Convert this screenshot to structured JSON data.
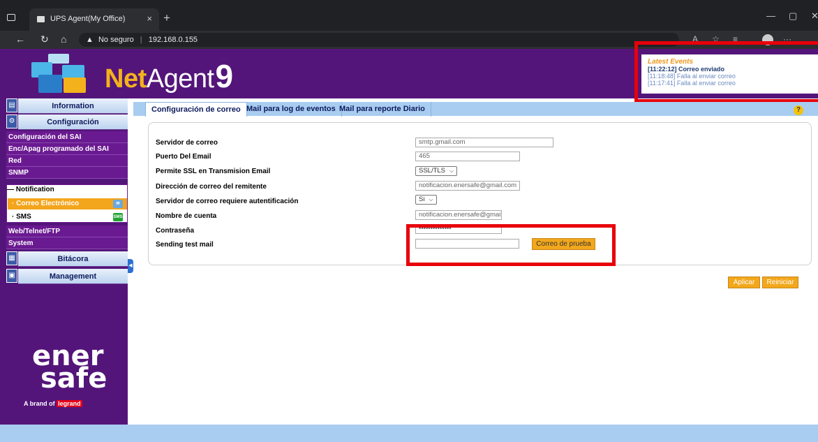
{
  "browser": {
    "tab_title": "UPS Agent(My Office)",
    "tab_close": "×",
    "new_tab": "+",
    "security_label": "No seguro",
    "url": "192.168.0.155"
  },
  "header": {
    "brand_net": "Net",
    "brand_agent": "Agent",
    "brand_nine": "9"
  },
  "events": {
    "title": "Latest Events",
    "items": [
      "[11:22:12] Correo enviado",
      "[11:18:48] Falla al enviar correo",
      "[11:17:41] Falla al enviar correo"
    ]
  },
  "sidebar": {
    "information": "Information",
    "configuracion": "Configuración",
    "items": [
      "Configuración del SAI",
      "Enc/Apag programado del SAI",
      "Red",
      "SNMP"
    ],
    "notification": "Notification",
    "sub_items": [
      "Correo Electrónico",
      "SMS"
    ],
    "sms_badge": "SMS",
    "items2": [
      "Web/Telnet/FTP",
      "System"
    ],
    "bitacora": "Bitácora",
    "management": "Management",
    "logo_line1": "ener",
    "logo_line2": "safe",
    "tagline_pre": "A brand of ",
    "tagline_brand": "legrand"
  },
  "tabs": [
    "Configuración de correo",
    "Mail para log de eventos",
    "Mail para reporte Diario"
  ],
  "help": "?",
  "form": {
    "fields": [
      {
        "label": "Servidor de correo",
        "value": "smtp.gmail.com"
      },
      {
        "label": "Puerto Del Email",
        "value": "465"
      },
      {
        "label": "Permite SSL en Transmision Email",
        "value": "SSL/TLS"
      },
      {
        "label": "Dirección de correo del remitente",
        "value": "notificacion.enersafe@gmail.com"
      },
      {
        "label": "Servidor de correo requiere autentificación",
        "value": "Si"
      },
      {
        "label": "Nombre de cuenta",
        "value": "notificacion.enersafe@gmail."
      },
      {
        "label": "Contraseña",
        "value": "••••••••••••••"
      },
      {
        "label": "Sending test mail",
        "value": ""
      }
    ],
    "test_button": "Correo de prueba"
  },
  "actions": {
    "apply": "Aplicar",
    "reset": "Reiniciar"
  },
  "colors": {
    "brand_purple": "#54157a",
    "accent_orange": "#f2a71c",
    "highlight_red": "#e8000b",
    "tab_blue": "#a9cdf0"
  }
}
